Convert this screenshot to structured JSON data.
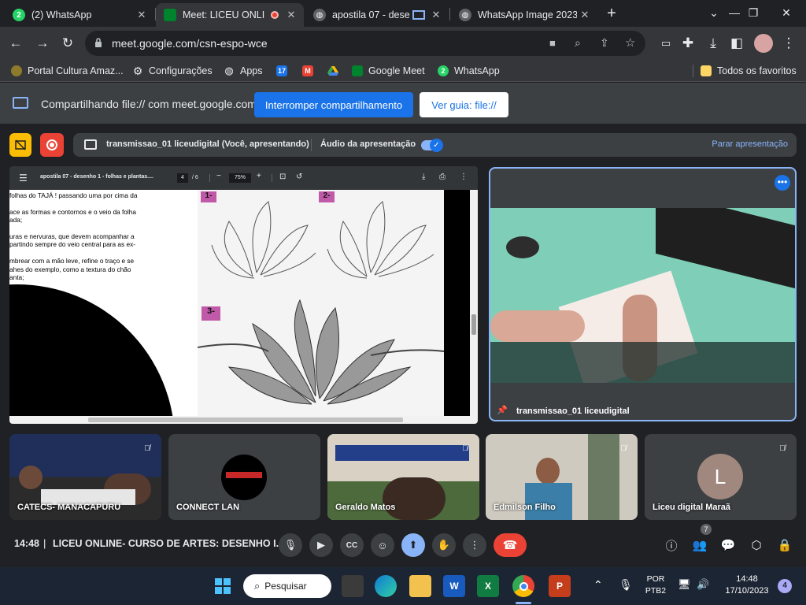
{
  "tabs": [
    {
      "title": "(2) WhatsApp",
      "icon": "whatsapp-icon",
      "favicon_text": "2",
      "active": false
    },
    {
      "title": "Meet: LICEU ONLI",
      "icon": "google-meet-icon",
      "active": true
    },
    {
      "title": "apostila 07 - dese",
      "icon": "globe-icon",
      "active": false
    },
    {
      "title": "WhatsApp Image 2023",
      "icon": "globe-icon",
      "active": false
    }
  ],
  "new_tab_label": "+",
  "address_bar": {
    "url": "meet.google.com/csn-espo-wce"
  },
  "bookmarks": [
    {
      "label": "Portal Cultura Amaz...",
      "icon": "portal-icon"
    },
    {
      "label": "Configurações",
      "icon": "gear-icon"
    },
    {
      "label": "Apps",
      "icon": "globe-icon"
    },
    {
      "label": "",
      "icon": "calendar-icon",
      "badge": "17"
    },
    {
      "label": "",
      "icon": "gmail-icon",
      "badge": "M"
    },
    {
      "label": "",
      "icon": "drive-icon"
    },
    {
      "label": "Google Meet",
      "icon": "google-meet-icon"
    },
    {
      "label": "WhatsApp",
      "icon": "whatsapp-icon",
      "badge": "2"
    }
  ],
  "all_bookmarks_label": "Todos os favoritos",
  "sharing_bar": {
    "text": "Compartilhando file:// com meet.google.com",
    "stop_button": "Interromper compartilhamento",
    "view_tab_button": "Ver guia: file://"
  },
  "presentation_bar": {
    "text": "transmissao_01 liceudigital (Você, apresentando)",
    "audio_label": "Áudio da apresentação",
    "audio_on": true,
    "stop_label": "Parar apresentação"
  },
  "pdf_viewer": {
    "title": "apostila 07 - desenho 1 - folhas e plantas....",
    "page_current": "4",
    "page_total": "/ 6",
    "zoom": "75%",
    "text_lines": [
      "folhas do TAJÁ ! passando uma por cima da",
      "",
      "ace as formas e contornos e o veio da folha",
      "ada;",
      "",
      "uras e nervuras, que devem acompanhar a",
      "partindo sempre do veio central para as ex-",
      "",
      "mbrear com a mão leve, refine o traço e se",
      "ahes do exemplo, como a textura do chão",
      "anta;"
    ],
    "step_labels": [
      "1-",
      "2-",
      "3-"
    ]
  },
  "speaker": {
    "name": "transmissao_01 liceudigital"
  },
  "participants": [
    {
      "name": "CATECS- MANACAPURU",
      "muted": true
    },
    {
      "name": "CONNECT LAN",
      "muted": false
    },
    {
      "name": "Geraldo Matos",
      "muted": true
    },
    {
      "name": "Edmilson Filho",
      "muted": true
    },
    {
      "name": "Liceu digital Maraã",
      "muted": true,
      "avatar_letter": "L",
      "avatar_color": "#a1887f"
    }
  ],
  "meeting": {
    "time": "14:48",
    "separator": "|",
    "title": "LICEU ONLINE- CURSO DE ARTES: DESENHO I...",
    "people_count": "7"
  },
  "taskbar": {
    "search_label": "Pesquisar",
    "lang_1": "POR",
    "lang_2": "PTB2",
    "clock_time": "14:48",
    "clock_date": "17/10/2023",
    "notifications": "4"
  },
  "colors": {
    "accent_blue": "#1a73e8",
    "meet_blue": "#8ab4f8",
    "end_call_red": "#ea4335",
    "pdf_step_purple": "#9c27b0"
  }
}
